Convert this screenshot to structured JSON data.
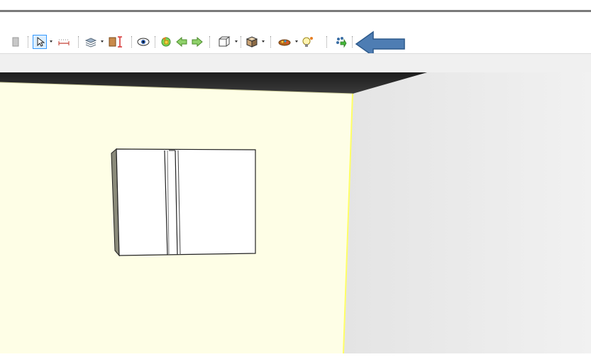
{
  "toolbar": {
    "tools": [
      {
        "name": "grip-icon"
      },
      {
        "name": "select-arrow-icon"
      },
      {
        "name": "dimension-icon"
      },
      {
        "name": "layers-icon"
      },
      {
        "name": "wall-tool-icon"
      },
      {
        "name": "eye-view-icon"
      },
      {
        "name": "rotate-view-icon"
      },
      {
        "name": "move-left-icon"
      },
      {
        "name": "move-right-icon"
      },
      {
        "name": "wireframe-cube-icon"
      },
      {
        "name": "solid-cube-icon"
      },
      {
        "name": "material-icon"
      },
      {
        "name": "light-bulb-icon"
      },
      {
        "name": "render-export-icon"
      }
    ],
    "annotation": {
      "name": "pointer-arrow",
      "color": "#4e7db3"
    }
  },
  "scene": {
    "colors": {
      "left_wall": "#fefee6",
      "right_wall": "#ececec",
      "ceiling": "#2a2a2a",
      "floor_edge": "#ffff66",
      "cabinet": "#ffffff"
    }
  }
}
